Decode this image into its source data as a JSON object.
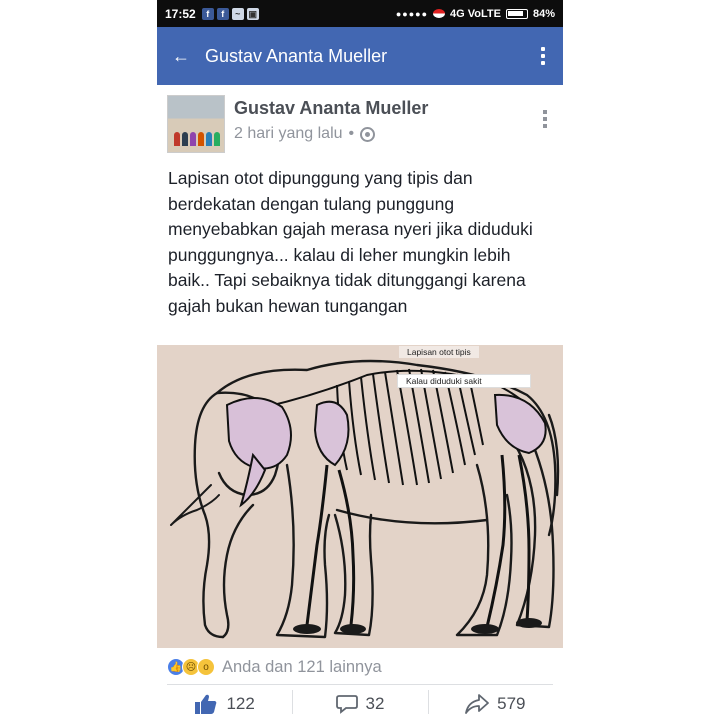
{
  "status_bar": {
    "time": "17:52",
    "notification_icons": [
      "facebook-icon",
      "facebook-icon",
      "messenger-icon",
      "gallery-icon"
    ],
    "network": "4G VoLTE",
    "battery": "84%"
  },
  "app_bar": {
    "title": "Gustav Ananta Mueller"
  },
  "post": {
    "author": "Gustav Ananta Mueller",
    "time": "2 hari yang lalu",
    "separator": "•",
    "privacy_icon": "globe-icon",
    "text": "Lapisan otot dipunggung yang tipis dan berdekatan dengan tulang punggung menyebabkan gajah merasa nyeri jika diduduki punggungnya... kalau di leher mungkin lebih baik.. Tapi sebaiknya tidak ditunggangi karena gajah bukan hewan tungangan",
    "image": {
      "label_top": "Lapisan otot tipis",
      "label_pain": "Kalau diduduki sakit"
    }
  },
  "reactions": {
    "icons": [
      "like",
      "sad",
      "wow"
    ],
    "summary": "Anda dan 121 lainnya"
  },
  "actions": {
    "like_count": "122",
    "comment_count": "32",
    "share_count": "579"
  },
  "colors": {
    "facebook_blue": "#4267b2",
    "status_bar": "#0d0d0d",
    "image_background": "#e3d3c8"
  }
}
